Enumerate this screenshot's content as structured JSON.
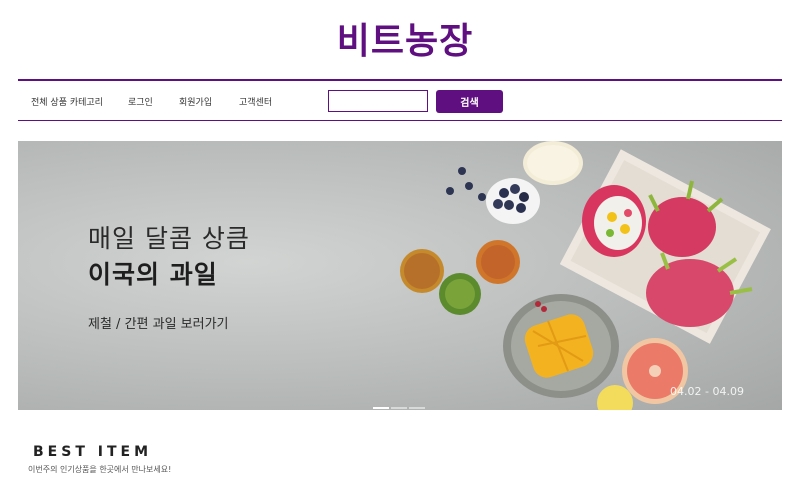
{
  "header": {
    "logo": "비트농장"
  },
  "nav": {
    "items": [
      "전체 상품 카테고리",
      "로그인",
      "회원가입",
      "고객센터"
    ],
    "search": {
      "value": "",
      "placeholder": "",
      "button_label": "검색"
    }
  },
  "banner": {
    "line1": "매일 달콤 상큼",
    "line2": "이국의 과일",
    "line3": "제철 / 간편 과일 보러가기",
    "dates": "04.02 - 04.09",
    "slide_count": 3,
    "active_slide": 1
  },
  "best": {
    "title": "BEST ITEM",
    "subtitle": "이번주의 인기상품을 한곳에서 만나보세요!"
  },
  "colors": {
    "brand": "#5f0f80",
    "banner_bg": "#b9bcbb"
  },
  "icons": {
    "slide_indicators": "slide-dots"
  }
}
